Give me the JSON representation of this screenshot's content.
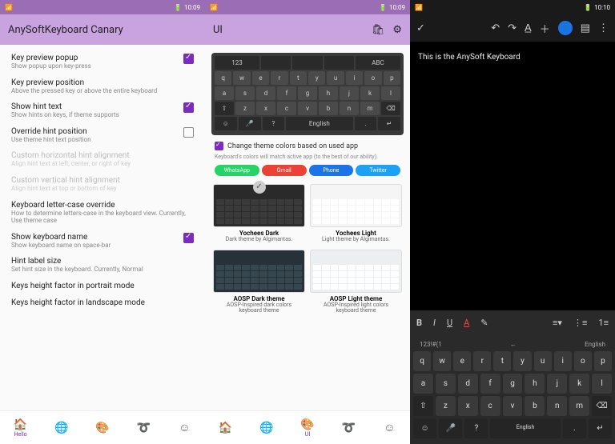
{
  "status": {
    "time1": "10:09",
    "time2": "10:09",
    "time3": "10:10",
    "battery": "48"
  },
  "phone1": {
    "title": "AnySoftKeyboard Canary",
    "settings": [
      {
        "title": "Key preview popup",
        "sub": "Show popup upon key-press",
        "checked": true,
        "disabled": false
      },
      {
        "title": "Key preview position",
        "sub": "Above the pressed key or above the entire keyboard",
        "checked": null,
        "disabled": false
      },
      {
        "title": "Show hint text",
        "sub": "Show hints on keys, if theme supports",
        "checked": true,
        "disabled": false
      },
      {
        "title": "Override hint position",
        "sub": "Use theme hint text position",
        "checked": false,
        "disabled": false
      },
      {
        "title": "Custom horizontal hint alignment",
        "sub": "Align hint text at left, center, or right of key",
        "checked": null,
        "disabled": true
      },
      {
        "title": "Custom vertical hint alignment",
        "sub": "Align hint text at top or bottom of key",
        "checked": null,
        "disabled": true
      },
      {
        "title": "Keyboard letter-case override",
        "sub": "How to determine letters-case in the keyboard view. Currently, Use theme case",
        "checked": null,
        "disabled": false
      },
      {
        "title": "Show keyboard name",
        "sub": "Show keyboard name on space-bar",
        "checked": true,
        "disabled": false
      },
      {
        "title": "Hint label size",
        "sub": "Set hint size in the keyboard. Currently, Normal",
        "checked": null,
        "disabled": false
      },
      {
        "title": "Keys height factor in portrait mode",
        "sub": "",
        "checked": null,
        "disabled": false
      },
      {
        "title": "Keys height factor in landscape mode",
        "sub": "",
        "checked": null,
        "disabled": false
      }
    ],
    "nav_active_label": "Hello"
  },
  "phone2": {
    "title": "UI",
    "kb": {
      "top_left": "123",
      "top_right": "ABC",
      "row1": [
        "q",
        "w",
        "e",
        "r",
        "t",
        "y",
        "u",
        "i",
        "o",
        "p"
      ],
      "row2": [
        "a",
        "s",
        "d",
        "f",
        "g",
        "h",
        "j",
        "k",
        "l"
      ],
      "row3_shift": "⇧",
      "row3": [
        "z",
        "x",
        "c",
        "v",
        "b",
        "n",
        "m"
      ],
      "row3_del": "⌫",
      "row4": {
        "emoji": "☺",
        "mic": "🎤",
        "q": "?",
        "space": "English",
        "dot": ".",
        "enter": "↵"
      }
    },
    "chk_label": "Change theme colors based on used app",
    "hint": "Keyboard's colors will match active app (to the best of our ability).",
    "pills": [
      {
        "label": "WhatsApp",
        "color": "#25d366"
      },
      {
        "label": "Gmail",
        "color": "#ea4335"
      },
      {
        "label": "Phone",
        "color": "#1a73e8"
      },
      {
        "label": "Twitter",
        "color": "#1da1f2"
      }
    ],
    "themes_row1": [
      {
        "name": "Yochees Dark",
        "desc": "Dark theme by Algimantas.",
        "bg": "#2a2a2a",
        "key": "#3a3a3a",
        "selected": true
      },
      {
        "name": "Yochees Light",
        "desc": "Light theme by Algimantas.",
        "bg": "#f5f5f5",
        "key": "#fff",
        "selected": false
      }
    ],
    "themes_row2": [
      {
        "name": "AOSP Dark theme",
        "desc": "AOSP-Inspired dark colors keyboard theme",
        "bg": "#263238",
        "key": "#37474f"
      },
      {
        "name": "AOSP Light theme",
        "desc": "AOSP-Inspired light colors keyboard theme",
        "bg": "#eceff1",
        "key": "#fff"
      }
    ],
    "nav_active_label": "UI"
  },
  "phone3": {
    "editor_text": "This is the AnySoft Keyboard",
    "format": {
      "b": "B",
      "i": "I",
      "u": "U",
      "a": "A"
    },
    "kb": {
      "top_left": "123!#(1",
      "top_arrow": "←",
      "top_right": "English",
      "row1": [
        "q",
        "w",
        "e",
        "r",
        "t",
        "y",
        "u",
        "i",
        "o",
        "p"
      ],
      "row2": [
        "a",
        "s",
        "d",
        "f",
        "g",
        "h",
        "j",
        "k",
        "l"
      ],
      "row3_shift": "⇧",
      "row3": [
        "z",
        "x",
        "c",
        "v",
        "b",
        "n",
        "m"
      ],
      "row3_del": "⌫",
      "row4": {
        "emoji": "☺",
        "mic": "🎤",
        "q": "?",
        "space": "English",
        "dot": ".",
        "enter": "↵"
      }
    }
  }
}
